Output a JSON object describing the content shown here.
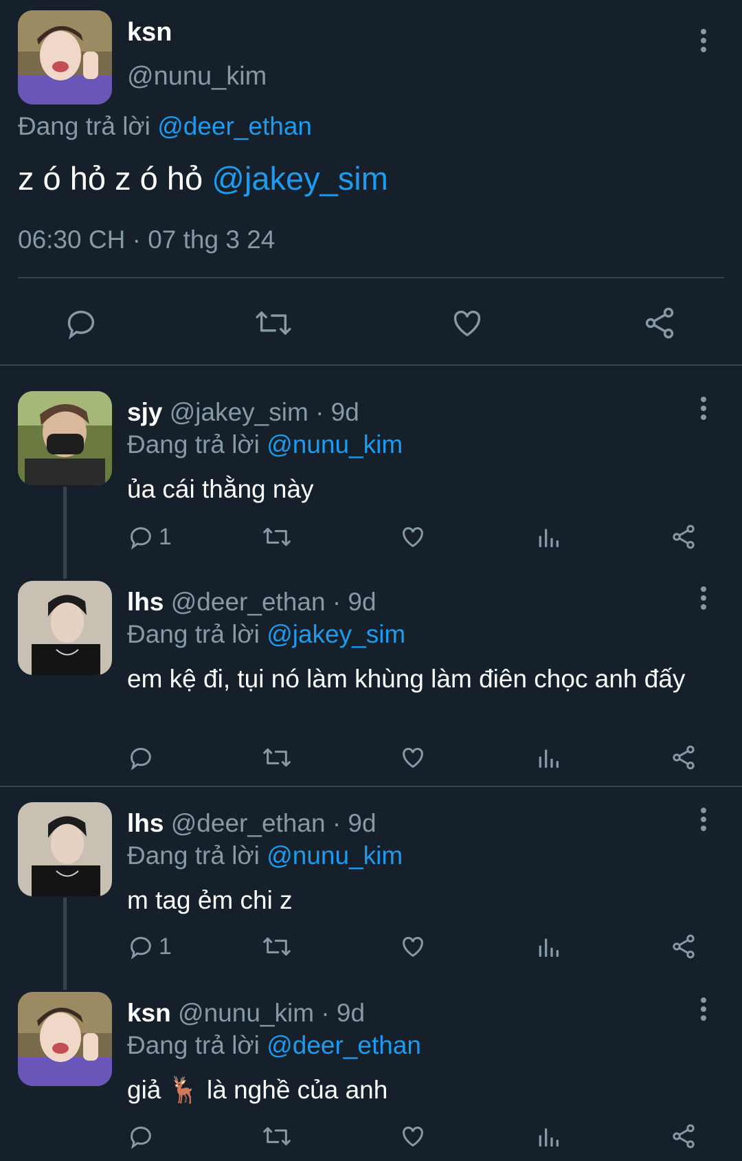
{
  "main_tweet": {
    "name": "ksn",
    "handle": "@nunu_kim",
    "replying_prefix": "Đang trả lời",
    "replying_to": "@deer_ethan",
    "text_plain": "z ó hỏ z ó hỏ",
    "text_mention": "@jakey_sim",
    "timestamp": "06:30 CH · 07 thg 3 24",
    "actions": [
      "reply-icon",
      "retweet-icon",
      "like-icon",
      "share-icon"
    ]
  },
  "replies": [
    {
      "name": "sjy",
      "handle": "@jakey_sim",
      "age": "· 9d",
      "replying_prefix": "Đang trả lời",
      "replying_to": "@nunu_kim",
      "text": "ủa cái thằng này",
      "reply_count": "1"
    },
    {
      "name": "lhs",
      "handle": "@deer_ethan",
      "age": "· 9d",
      "replying_prefix": "Đang trả lời",
      "replying_to": "@jakey_sim",
      "text": "em kệ đi, tụi nó làm khùng làm điên chọc anh đấy",
      "reply_count": ""
    },
    {
      "name": "lhs",
      "handle": "@deer_ethan",
      "age": "· 9d",
      "replying_prefix": "Đang trả lời",
      "replying_to": "@nunu_kim",
      "text": "m tag ẻm chi z",
      "reply_count": "1"
    },
    {
      "name": "ksn",
      "handle": "@nunu_kim",
      "age": "· 9d",
      "replying_prefix": "Đang trả lời",
      "replying_to": "@deer_ethan",
      "text": "giả 🦌 là nghề của anh",
      "reply_count": ""
    }
  ],
  "colors": {
    "background": "#15202b",
    "link": "#1d9bf0",
    "muted": "#8899a6",
    "divider": "#38444d"
  }
}
